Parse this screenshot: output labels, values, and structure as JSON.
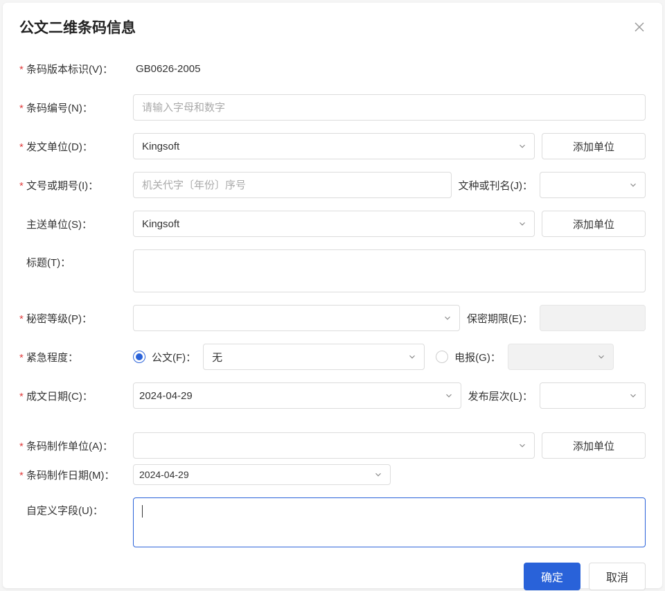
{
  "dialog": {
    "title": "公文二维条码信息"
  },
  "labels": {
    "version": "条码版本标识(V)：",
    "barcode_no": "条码编号(N)：",
    "send_unit": "发文单位(D)：",
    "doc_number": "文号或期号(I)：",
    "doc_type": "文种或刊名(J)：",
    "main_send": "主送单位(S)：",
    "title": "标题(T)：",
    "secret_level": "秘密等级(P)：",
    "secret_period": "保密期限(E)：",
    "urgency": "紧急程度：",
    "official": "公文(F)：",
    "telegram": "电报(G)：",
    "compose_date": "成文日期(C)：",
    "publish_level": "发布层次(L)：",
    "barcode_unit": "条码制作单位(A)：",
    "barcode_date": "条码制作日期(M)：",
    "custom_field": "自定义字段(U)："
  },
  "values": {
    "version": "GB0626-2005",
    "send_unit": "Kingsoft",
    "main_send": "Kingsoft",
    "urgency_official": "无",
    "compose_date": "2024-04-29",
    "barcode_date": "2024-04-29"
  },
  "placeholders": {
    "barcode_no": "请输入字母和数字",
    "doc_number": "机关代字〔年份〕序号"
  },
  "buttons": {
    "add_unit": "添加单位",
    "confirm": "确定",
    "cancel": "取消"
  }
}
